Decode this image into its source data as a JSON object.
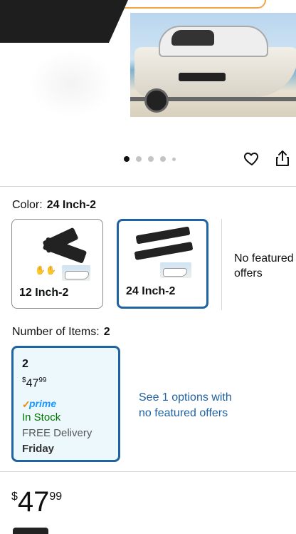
{
  "gallery": {
    "dots_count": 5,
    "active_dot": 0
  },
  "color": {
    "label": "Color:",
    "selected": "24 Inch-2",
    "options": [
      {
        "label": "12 Inch-2"
      },
      {
        "label": "24 Inch-2"
      }
    ],
    "no_featured": "No featured\noffers"
  },
  "items": {
    "label": "Number of Items:",
    "selected": "2"
  },
  "offer": {
    "qty": "2",
    "price_currency": "$",
    "price_whole": "47",
    "price_frac": "99",
    "prime": "prime",
    "prime_check": "✓",
    "stock": "In Stock",
    "delivery": "FREE Delivery",
    "delivery_day": "Friday"
  },
  "see_options": "See 1 options with\nno featured offers",
  "price": {
    "currency": "$",
    "whole": "47",
    "fraction": "99"
  },
  "colors": {
    "accent_blue": "#2162a1",
    "instock_green": "#007600",
    "prime_blue": "#1a98ff"
  }
}
